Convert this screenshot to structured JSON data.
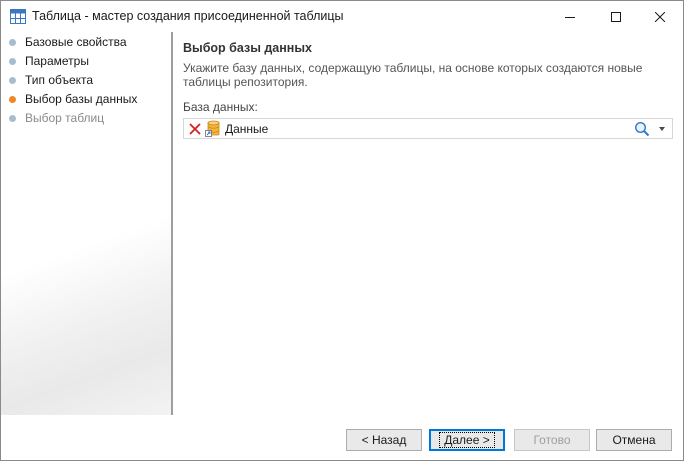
{
  "window": {
    "title": "Таблица - мастер создания присоединенной таблицы",
    "icon": "table-icon",
    "controls": {
      "minimize": "minimize-icon",
      "maximize": "maximize-icon",
      "close": "close-icon"
    }
  },
  "sidebar": {
    "steps": [
      {
        "label": "Базовые свойства",
        "state": "done",
        "dot_color": "#a8bcd0"
      },
      {
        "label": "Параметры",
        "state": "done",
        "dot_color": "#a8bcd0"
      },
      {
        "label": "Тип объекта",
        "state": "done",
        "dot_color": "#a8bcd0"
      },
      {
        "label": "Выбор базы данных",
        "state": "current",
        "dot_color": "#f0882a"
      },
      {
        "label": "Выбор таблиц",
        "state": "pending",
        "dot_color": "#a8bcd0"
      }
    ]
  },
  "main": {
    "heading": "Выбор базы данных",
    "description": "Укажите базу данных, содержащую таблицы, на основе которых создаются новые таблицы репозитория.",
    "field_label": "База данных:",
    "db_picker": {
      "value": "Данные",
      "icons": [
        "clear-icon",
        "database-icon",
        "search-icon",
        "chevron-down-icon"
      ]
    }
  },
  "footer": {
    "back_label": "< Назад",
    "next_label": "Далее >",
    "finish_label": "Готово",
    "cancel_label": "Отмена"
  },
  "colors": {
    "current_step_text": "#1a1a1a",
    "pending_step_text": "#8a8a8a",
    "accent": "#0078d7"
  }
}
